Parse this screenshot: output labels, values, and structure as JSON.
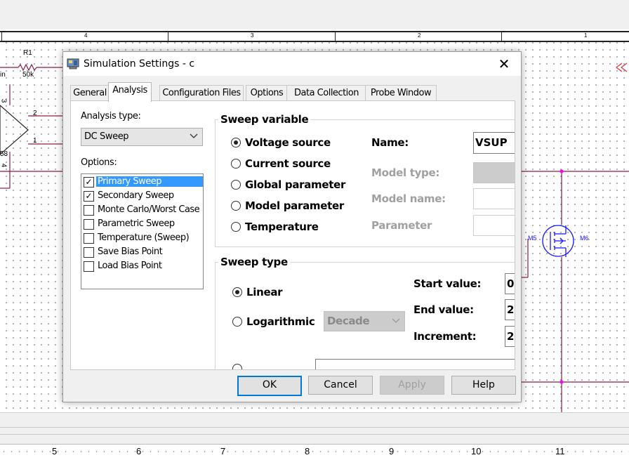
{
  "border_ruler": {
    "marks": [
      "4",
      "3",
      "2",
      "1"
    ]
  },
  "schematic": {
    "labels": {
      "r1": "R1",
      "r1_value": "50k",
      "in_label": "in",
      "pin_2": "2",
      "pin_1": "1",
      "pin_3": "3",
      "pin_4": "4",
      "u_58": "58",
      "m5": "M5",
      "m6": "M6"
    },
    "colors": {
      "wire": "#8b1a4a",
      "node": "#ff00ff",
      "mosfet": "#1a1aff",
      "net_label": "#e03030"
    }
  },
  "bottom_ruler": {
    "marks": [
      "5",
      "6",
      "7",
      "8",
      "9",
      "10",
      "11"
    ]
  },
  "dialog": {
    "title": "Simulation Settings - c",
    "close_symbol": "✕",
    "tabs": [
      {
        "label": "General"
      },
      {
        "label": "Analysis"
      },
      {
        "label": "Configuration Files"
      },
      {
        "label": "Options"
      },
      {
        "label": "Data Collection"
      },
      {
        "label": "Probe Window"
      }
    ],
    "active_tab": "Analysis",
    "analysis_type": {
      "label": "Analysis type:",
      "value": "DC Sweep"
    },
    "options": {
      "label": "Options:",
      "items": [
        {
          "label": "Primary Sweep",
          "checked": true,
          "selected": true
        },
        {
          "label": "Secondary Sweep",
          "checked": true,
          "selected": false
        },
        {
          "label": "Monte Carlo/Worst Case",
          "checked": false,
          "selected": false
        },
        {
          "label": "Parametric Sweep",
          "checked": false,
          "selected": false
        },
        {
          "label": "Temperature (Sweep)",
          "checked": false,
          "selected": false
        },
        {
          "label": "Save Bias Point",
          "checked": false,
          "selected": false
        },
        {
          "label": "Load Bias Point",
          "checked": false,
          "selected": false
        }
      ]
    },
    "sweep_variable": {
      "title": "Sweep variable",
      "radios": [
        {
          "label": "Voltage source",
          "selected": true
        },
        {
          "label": "Current source",
          "selected": false
        },
        {
          "label": "Global parameter",
          "selected": false
        },
        {
          "label": "Model parameter",
          "selected": false
        },
        {
          "label": "Temperature",
          "selected": false
        }
      ],
      "name_label": "Name:",
      "name_value": "VSUP",
      "model_type_label": "Model type:",
      "model_name_label": "Model name:",
      "parameter_label": "Parameter"
    },
    "sweep_type": {
      "title": "Sweep type",
      "linear_label": "Linear",
      "linear_selected": true,
      "log_label": "Logarithmic",
      "log_selected": false,
      "log_scale_value": "Decade",
      "start_label": "Start value:",
      "start_value": "0",
      "end_label": "End value:",
      "end_value": "2",
      "increment_label": "Increment:",
      "increment_value": "2"
    },
    "buttons": {
      "ok": "OK",
      "cancel": "Cancel",
      "apply": "Apply",
      "help": "Help"
    }
  }
}
